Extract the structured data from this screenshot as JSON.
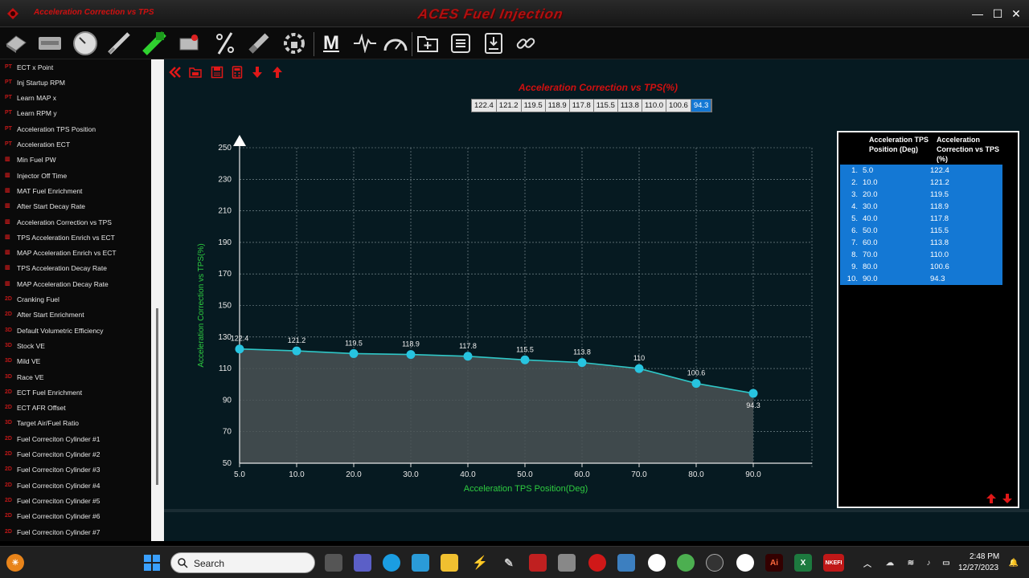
{
  "window": {
    "title": "Acceleration Correction vs TPS",
    "brand": "ACES Fuel Injection",
    "minimize": "—",
    "maximize": "☐",
    "close": "✕"
  },
  "toolbar": {
    "icons": [
      "ecu-icon",
      "keyboard-icon",
      "gauge-clock-icon",
      "injector-icon",
      "sensor-icon",
      "throttle-icon",
      "percent-icon",
      "spark-plug-icon",
      "gear-lock-icon",
      "macro-m-icon",
      "pulse-icon",
      "speedometer-icon",
      "new-folder-icon",
      "list-icon",
      "download-icon",
      "link-icon"
    ],
    "macro_label": "M"
  },
  "sidebar": {
    "items": [
      {
        "tag": "PT",
        "label": "ECT x Point"
      },
      {
        "tag": "PT",
        "label": "Inj Startup RPM"
      },
      {
        "tag": "PT",
        "label": "Learn MAP x"
      },
      {
        "tag": "PT",
        "label": "Learn RPM y"
      },
      {
        "tag": "PT",
        "label": "Acceleration TPS Position"
      },
      {
        "tag": "PT",
        "label": "Acceleration ECT"
      },
      {
        "tag": "▥",
        "label": "Min Fuel PW"
      },
      {
        "tag": "▥",
        "label": "Injector Off Time"
      },
      {
        "tag": "▥",
        "label": "MAT Fuel Enrichment"
      },
      {
        "tag": "▥",
        "label": "After Start Decay Rate"
      },
      {
        "tag": "▥",
        "label": "Acceleration Correction vs TPS"
      },
      {
        "tag": "▥",
        "label": "TPS Acceleration Enrich vs ECT"
      },
      {
        "tag": "▥",
        "label": "MAP Acceleration Enrich vs ECT"
      },
      {
        "tag": "▥",
        "label": "TPS Acceleration Decay Rate"
      },
      {
        "tag": "▥",
        "label": "MAP Acceleration Decay Rate"
      },
      {
        "tag": "2D",
        "label": "Cranking Fuel"
      },
      {
        "tag": "2D",
        "label": "After Start Enrichment"
      },
      {
        "tag": "3D",
        "label": "Default Volumetric Efficiency"
      },
      {
        "tag": "3D",
        "label": "Stock VE"
      },
      {
        "tag": "3D",
        "label": "Mild VE"
      },
      {
        "tag": "3D",
        "label": "Race VE"
      },
      {
        "tag": "2D",
        "label": "ECT Fuel Enrichment"
      },
      {
        "tag": "2D",
        "label": "ECT AFR Offset"
      },
      {
        "tag": "3D",
        "label": "Target Air/Fuel Ratio"
      },
      {
        "tag": "2D",
        "label": "Fuel Correciton Cylinder #1"
      },
      {
        "tag": "2D",
        "label": "Fuel Correciton Cylinder #2"
      },
      {
        "tag": "2D",
        "label": "Fuel Correciton Cylinder #3"
      },
      {
        "tag": "2D",
        "label": "Fuel Correciton Cylinder #4"
      },
      {
        "tag": "2D",
        "label": "Fuel Correciton Cylinder #5"
      },
      {
        "tag": "2D",
        "label": "Fuel Correciton Cylinder #6"
      },
      {
        "tag": "2D",
        "label": "Fuel Correciton Cylinder #7"
      }
    ]
  },
  "main": {
    "actions": [
      "collapse-left-icon",
      "open-folder-icon",
      "save-icon",
      "calculator-icon",
      "arrow-down-icon",
      "arrow-up-icon"
    ],
    "chart_title": "Acceleration Correction vs TPS(%)",
    "value_strip": [
      "122.4",
      "121.2",
      "119.5",
      "118.9",
      "117.8",
      "115.5",
      "113.8",
      "110.0",
      "100.6",
      "94.3"
    ],
    "selected_index": 9
  },
  "chart_data": {
    "type": "area",
    "xlabel": "Acceleration TPS Position(Deg)",
    "ylabel": "Acceleration Correction vs TPS(%)",
    "x": [
      5.0,
      10.0,
      20.0,
      30.0,
      40.0,
      50.0,
      60.0,
      70.0,
      80.0,
      90.0
    ],
    "x_tick_labels": [
      "5.0",
      "10.0",
      "20.0",
      "30.0",
      "40.0",
      "50.0",
      "60.0",
      "70.0",
      "80.0",
      "90.0"
    ],
    "values": [
      122.4,
      121.2,
      119.5,
      118.9,
      117.8,
      115.5,
      113.8,
      110.0,
      100.6,
      94.3
    ],
    "point_labels": [
      "122.4",
      "121.2",
      "119.5",
      "118.9",
      "117.8",
      "115.5",
      "113.8",
      "110",
      "100.6",
      "94.3"
    ],
    "ylim": [
      50,
      250
    ],
    "y_ticks": [
      50,
      70,
      90,
      110,
      130,
      150,
      170,
      190,
      210,
      230,
      250
    ],
    "grid": true,
    "colors": {
      "line": "#2fc7c7",
      "point": "#27c4e0",
      "fill": "#4a5254",
      "axis_label": "#2ecc40",
      "title": "#d01010"
    }
  },
  "table": {
    "col1": "Acceleration TPS Position (Deg)",
    "col2": "Acceleration Correction vs TPS (%)",
    "rows": [
      {
        "n": "1.",
        "a": "5.0",
        "b": "122.4"
      },
      {
        "n": "2.",
        "a": "10.0",
        "b": "121.2"
      },
      {
        "n": "3.",
        "a": "20.0",
        "b": "119.5"
      },
      {
        "n": "4.",
        "a": "30.0",
        "b": "118.9"
      },
      {
        "n": "5.",
        "a": "40.0",
        "b": "117.8"
      },
      {
        "n": "6.",
        "a": "50.0",
        "b": "115.5"
      },
      {
        "n": "7.",
        "a": "60.0",
        "b": "113.8"
      },
      {
        "n": "8.",
        "a": "70.0",
        "b": "110.0"
      },
      {
        "n": "9.",
        "a": "80.0",
        "b": "100.6"
      },
      {
        "n": "10.",
        "a": "90.0",
        "b": "94.3"
      }
    ]
  },
  "taskbar": {
    "search_placeholder": "Search",
    "time": "2:48 PM",
    "date": "12/27/2023",
    "apps": [
      "widgets-icon",
      "start-icon",
      "search-icon",
      "task-view-icon",
      "teams-icon",
      "edge-icon",
      "notepad-icon",
      "file-explorer-icon",
      "power-automate-icon",
      "tools-icon",
      "red-app-icon",
      "snip-icon",
      "aces-icon",
      "calculator-icon",
      "teamviewer-icon",
      "chrome-icon",
      "obs-icon",
      "teamviewer2-icon",
      "illustrator-icon",
      "excel-icon",
      "nkefi-icon"
    ],
    "nkefi_label": "NKEFI",
    "ai_label": "Ai",
    "excel_label": "X"
  }
}
